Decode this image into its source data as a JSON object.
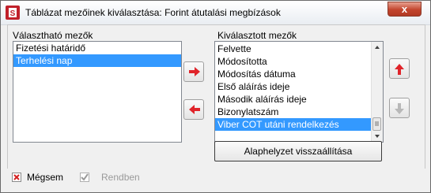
{
  "window": {
    "title": "Táblázat mezőinek kiválasztása: Forint átutalási megbízások",
    "close_label": "x"
  },
  "available": {
    "label": "Választható mezők",
    "items": [
      "Fizetési határidő",
      "Terhelési nap"
    ],
    "selected_index": 1
  },
  "chosen": {
    "label": "Kiválasztott mezők",
    "items": [
      "Felvette",
      "Módosította",
      "Módosítás dátuma",
      "Első aláírás ideje",
      "Második aláírás ideje",
      "Bizonylatszám",
      "Viber COT utáni rendelkezés"
    ],
    "selected_index": 6
  },
  "buttons": {
    "reset_label": "Alaphelyzet visszaállítása",
    "cancel_label": "Mégsem",
    "ok_label": "Rendben"
  },
  "colors": {
    "selection": "#3399ff",
    "arrow_red": "#e0242a",
    "arrow_disabled": "#b8b8b8"
  }
}
